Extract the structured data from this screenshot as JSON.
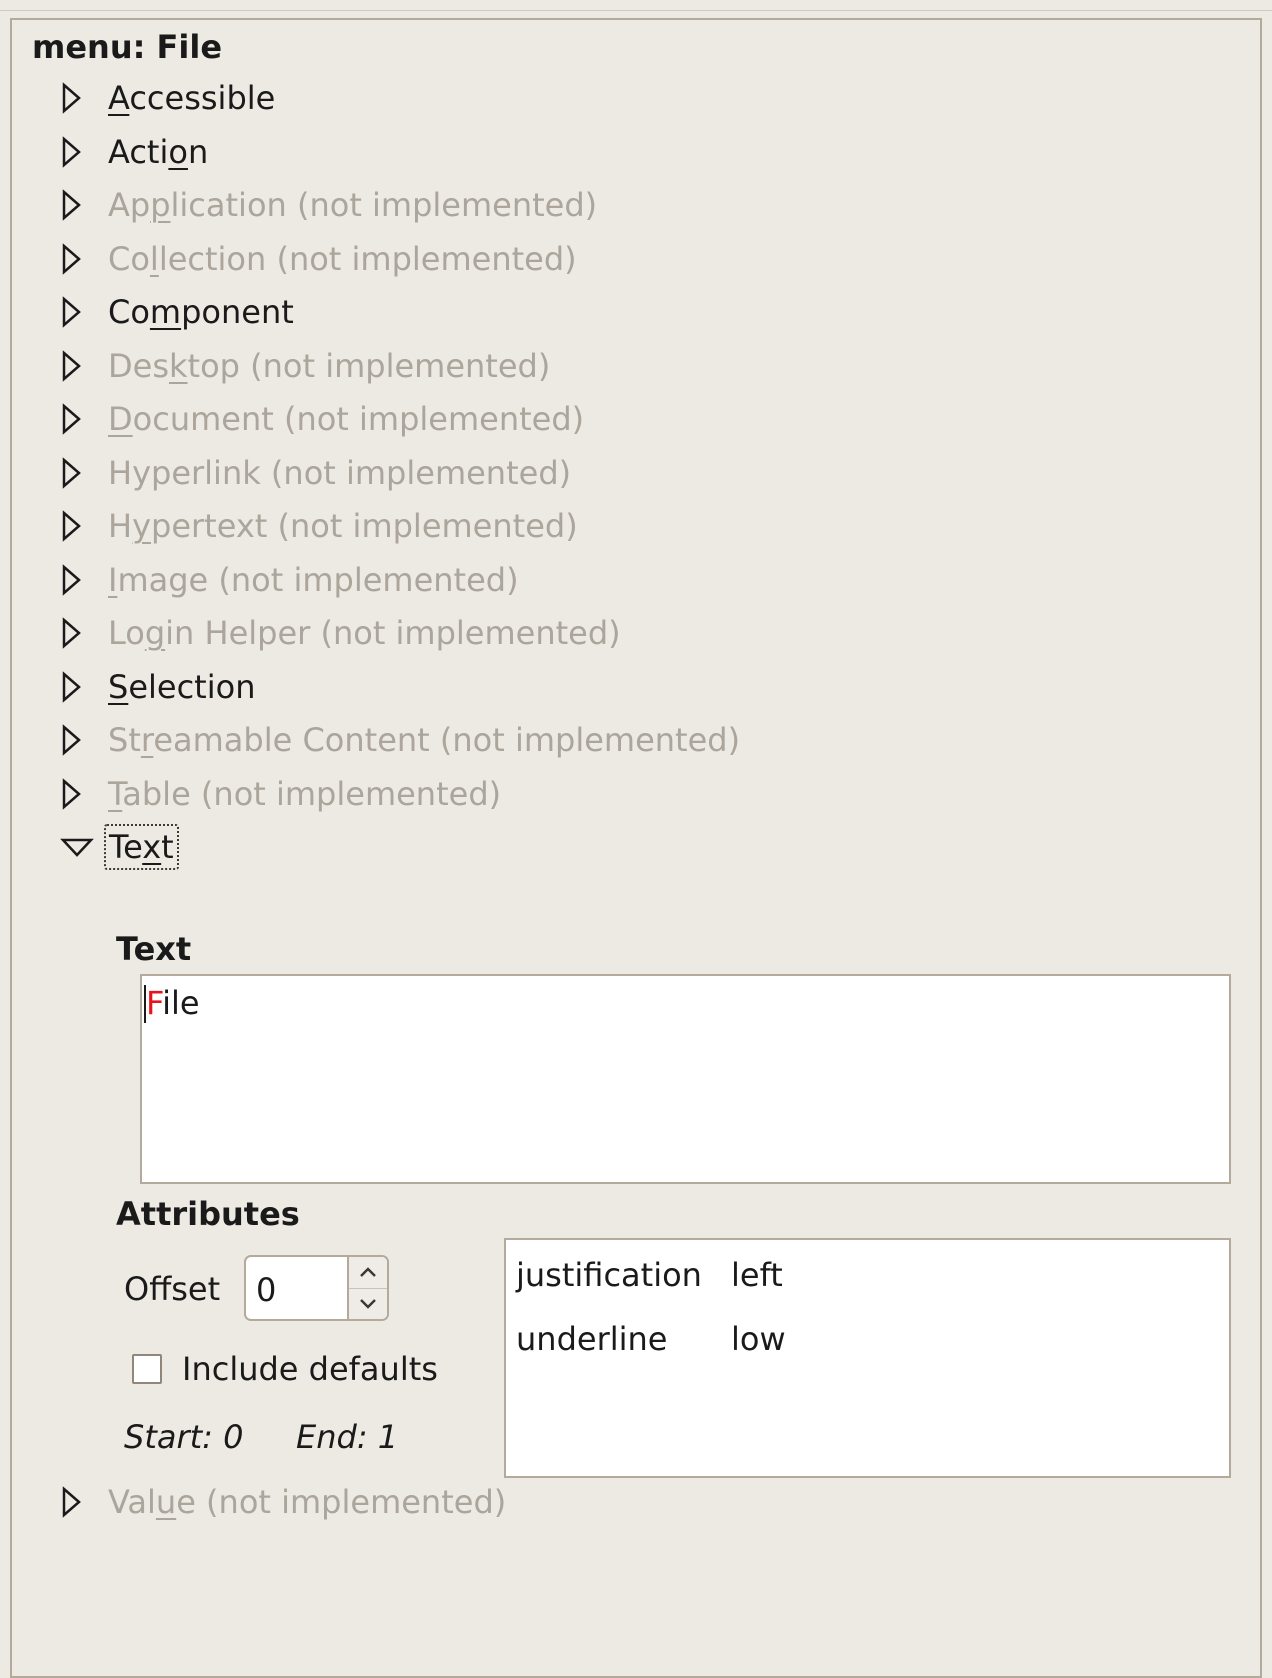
{
  "panel": {
    "title": "menu: File"
  },
  "interfaces": [
    {
      "pre": "",
      "u": "A",
      "post": "ccessible",
      "state": "enabled",
      "expanded": false
    },
    {
      "pre": "Acti",
      "u": "o",
      "post": "n",
      "state": "enabled",
      "expanded": false
    },
    {
      "pre": "Ap",
      "u": "p",
      "post": "lication (not implemented)",
      "state": "disabled",
      "expanded": false
    },
    {
      "pre": "Co",
      "u": "l",
      "post": "lection (not implemented)",
      "state": "disabled",
      "expanded": false
    },
    {
      "pre": "Co",
      "u": "m",
      "post": "ponent",
      "state": "enabled",
      "expanded": false
    },
    {
      "pre": "Des",
      "u": "k",
      "post": "top (not implemented)",
      "state": "disabled",
      "expanded": false
    },
    {
      "pre": "",
      "u": "D",
      "post": "ocument (not implemented)",
      "state": "disabled",
      "expanded": false
    },
    {
      "pre": "Hyperlink (not implemented)",
      "u": "",
      "post": "",
      "state": "disabled",
      "expanded": false
    },
    {
      "pre": "H",
      "u": "y",
      "post": "pertext (not implemented)",
      "state": "disabled",
      "expanded": false
    },
    {
      "pre": "",
      "u": "I",
      "post": "mage (not implemented)",
      "state": "disabled",
      "expanded": false
    },
    {
      "pre": "Lo",
      "u": "g",
      "post": "in Helper (not implemented)",
      "state": "disabled",
      "expanded": false
    },
    {
      "pre": "",
      "u": "S",
      "post": "election",
      "state": "enabled",
      "expanded": false
    },
    {
      "pre": "St",
      "u": "r",
      "post": "eamable Content (not implemented)",
      "state": "disabled",
      "expanded": false
    },
    {
      "pre": "",
      "u": "T",
      "post": "able (not implemented)",
      "state": "disabled",
      "expanded": false
    },
    {
      "pre": "Te",
      "u": "x",
      "post": "t",
      "state": "enabled",
      "expanded": true
    }
  ],
  "value_interface": {
    "pre": "Val",
    "u": "u",
    "post": "e (not implemented)",
    "state": "disabled",
    "expanded": false
  },
  "text_section": {
    "heading": "Text",
    "first_char": "F",
    "rest": "ile",
    "first_char_color": "#e8141d"
  },
  "attributes_section": {
    "heading": "Attributes",
    "offset_label": "Offset",
    "offset_value": "0",
    "include_defaults_label": "Include defaults",
    "include_defaults_checked": false,
    "start_label": "Start: 0",
    "end_label": "End: 1",
    "attributes": [
      {
        "name": "justification",
        "value": "left"
      },
      {
        "name": "underline",
        "value": "low"
      }
    ]
  },
  "colors": {
    "background": "#edeae4",
    "border": "#b3aa9c",
    "disabled_text": "#aba59b",
    "enabled_text": "#1a1a1a"
  }
}
